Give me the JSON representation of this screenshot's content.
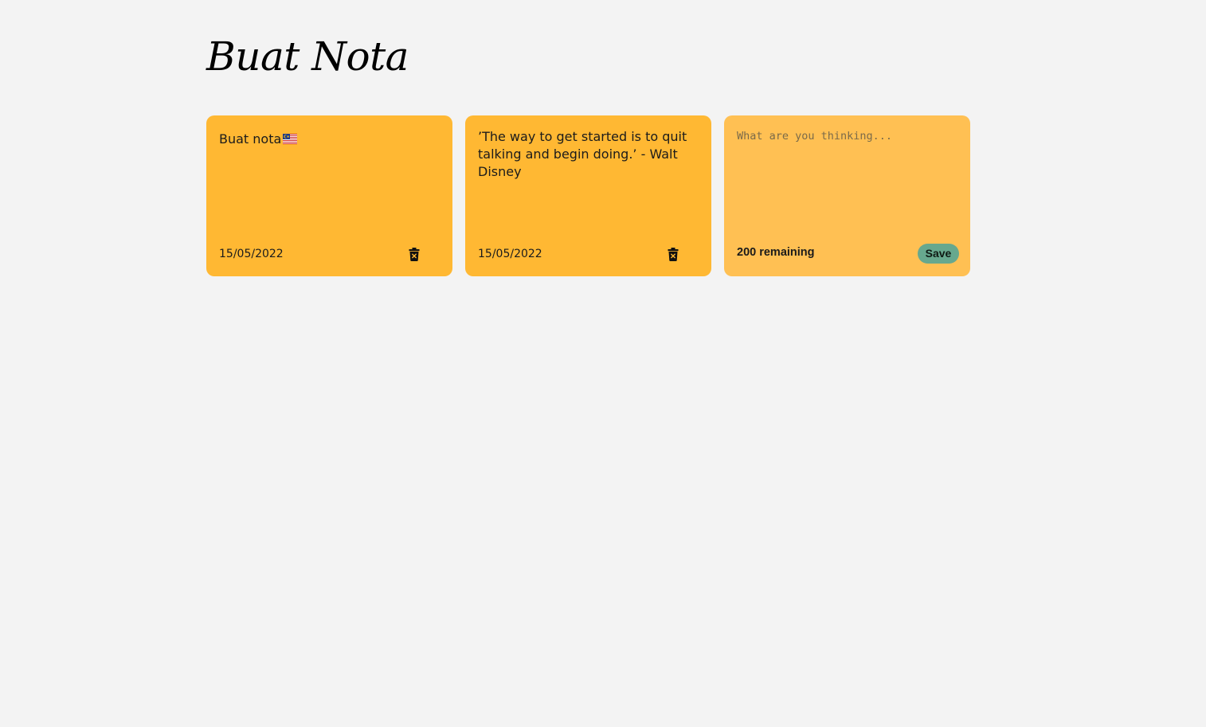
{
  "header": {
    "title": "Buat Nota"
  },
  "notes": [
    {
      "text": "Buat nota",
      "emoji_icon": "malaysia-flag-icon",
      "date": "15/05/2022",
      "delete_icon": "trash-delete-icon"
    },
    {
      "text": "’The way to get started is to quit talking and begin doing.’ - Walt Disney",
      "date": "15/05/2022",
      "delete_icon": "trash-delete-icon"
    }
  ],
  "new_note": {
    "placeholder": "What are you thinking...",
    "value": "",
    "remaining_label": "200 remaining",
    "save_label": "Save"
  },
  "colors": {
    "background": "#f3f3f3",
    "note": "#ffb833",
    "new_note": "#ffc053",
    "save_button": "#67a88e"
  }
}
